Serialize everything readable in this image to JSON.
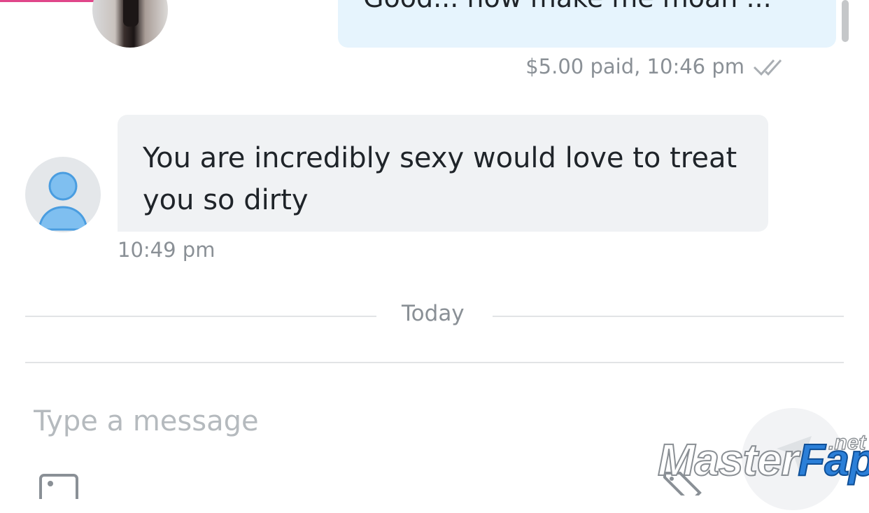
{
  "conversation": {
    "outgoing_message": {
      "text": "Good... now make me moan ...",
      "meta": "$5.00 paid, 10:46 pm",
      "status_icon": "double-check-icon"
    },
    "incoming_message": {
      "text": "You are incredibly sexy would love to treat you so dirty",
      "time": "10:49 pm",
      "avatar_icon": "default-user-icon"
    },
    "day_divider": "Today"
  },
  "composer": {
    "placeholder": "Type a message",
    "value": "",
    "media_icon": "image-icon",
    "tag_icon": "price-tag-icon",
    "send_icon": "send-icon"
  },
  "watermark": {
    "part1": "Master",
    "part2": "Fap",
    "suffix": ".net"
  },
  "colors": {
    "accent": "#e0468a",
    "outgoing_bubble": "#e6f4fd",
    "incoming_bubble": "#f0f2f4",
    "meta_text": "#8a9096",
    "avatar_blue": "#5aaeea"
  }
}
